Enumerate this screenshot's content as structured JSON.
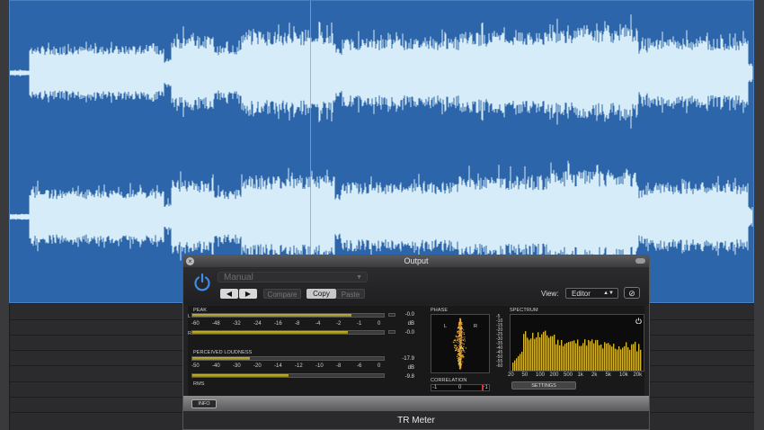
{
  "plugin": {
    "window_title": "Output",
    "preset": "Manual",
    "buttons": {
      "prev": "◀",
      "next": "▶",
      "compare": "Compare",
      "copy": "Copy",
      "paste": "Paste",
      "link": "⊘"
    },
    "view_label": "View:",
    "view_value": "Editor",
    "name": "TR Meter",
    "info_button": "INFO",
    "settings_button": "SETTINGS"
  },
  "meters": {
    "peak_label": "PEAK",
    "left_label": "L",
    "right_label": "R",
    "peak_scale": [
      "-60",
      "-48",
      "-32",
      "-24",
      "-16",
      "-8",
      "-4",
      "-2",
      "-1",
      "0"
    ],
    "peak_left_value": "-0.0",
    "peak_right_value": "-0.0",
    "peak_unit": "dB",
    "peak_left_level": 0.83,
    "peak_right_level": 0.81,
    "loudness_label": "PERCEIVED LOUDNESS",
    "loudness_scale": [
      "-50",
      "-40",
      "-30",
      "-20",
      "-14",
      "-12",
      "-10",
      "-8",
      "-6",
      "0"
    ],
    "loudness_value": "-17.9",
    "loudness_unit": "dB",
    "loudness_level": 0.3,
    "rms_label": "RMS",
    "rms_value": "-9.8",
    "rms_level": 0.5
  },
  "phase": {
    "label": "PHASE",
    "left": "L",
    "right": "R",
    "correlation_label": "CORRELATION",
    "corr_scale": [
      "-1",
      "0",
      "+1"
    ],
    "corr_value": 0.82
  },
  "spectrum": {
    "label": "SPECTRUM",
    "y_ticks": [
      "-5",
      "-10",
      "-15",
      "-20",
      "-25",
      "-30",
      "-35",
      "-40",
      "-45",
      "-50",
      "-55",
      "-60"
    ],
    "x_ticks": [
      "20",
      "50",
      "100",
      "200",
      "500",
      "1k",
      "2k",
      "5k",
      "10k",
      "20k"
    ]
  },
  "colors": {
    "waveform_bg": "#2c65a9",
    "waveform": "#d6ecf8",
    "meter_fill": "#c7b63b",
    "power_icon": "#3e8be8"
  }
}
